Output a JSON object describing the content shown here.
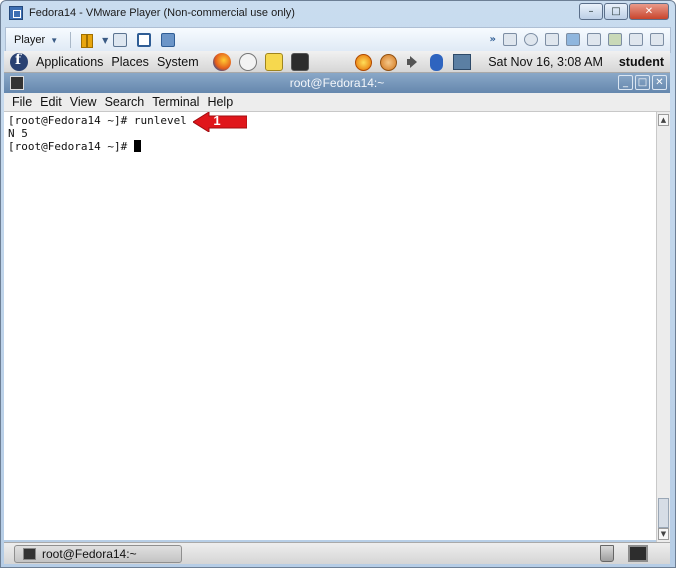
{
  "host": {
    "title": "Fedora14 - VMware Player (Non-commercial use only)",
    "window_controls": [
      "–",
      "□",
      "✕"
    ],
    "toolbar": {
      "player_label": "Player"
    }
  },
  "guest_panel": {
    "menus": [
      "Applications",
      "Places",
      "System"
    ],
    "clock": "Sat Nov 16,  3:08 AM",
    "user": "student"
  },
  "terminal": {
    "title": "root@Fedora14:~",
    "menus": [
      "File",
      "Edit",
      "View",
      "Search",
      "Terminal",
      "Help"
    ],
    "lines": [
      "[root@Fedora14 ~]# runlevel",
      "N 5",
      "[root@Fedora14 ~]# "
    ]
  },
  "taskbar": {
    "task_label": "root@Fedora14:~"
  },
  "annotation": {
    "step": "1",
    "color": "#e0161b"
  }
}
